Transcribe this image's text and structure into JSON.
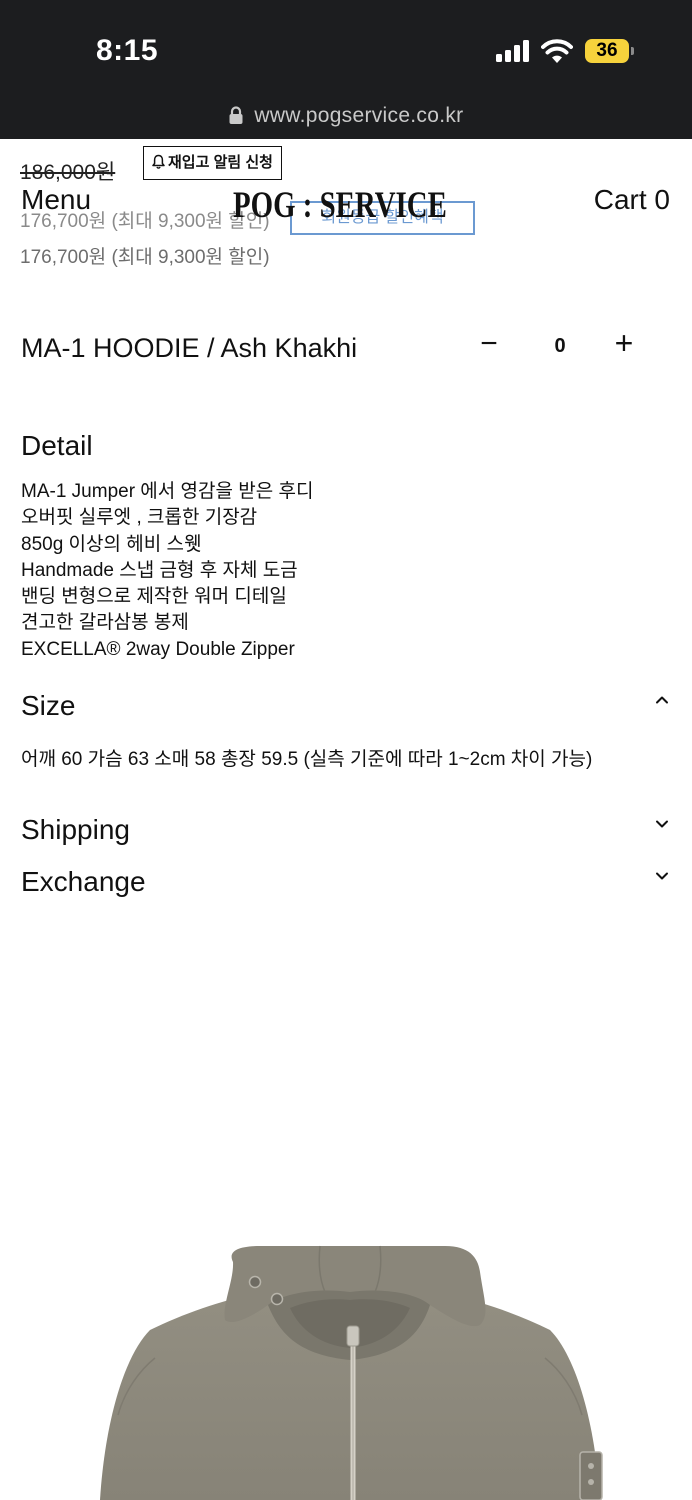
{
  "status_bar": {
    "time": "8:15",
    "battery": "36",
    "url": "www.pogservice.co.kr",
    "icons": [
      "signal-icon",
      "wifi-icon",
      "battery-icon",
      "lock-icon"
    ]
  },
  "header": {
    "menu_label": "Menu",
    "logo_text": "POG : SERVICE",
    "cart_label": "Cart 0"
  },
  "pricing": {
    "original_price": "186,000원",
    "restock_label": "재입고 알림 신청",
    "sale_price_faded": "176,700원 (최대 9,300원 할인)",
    "member_button": "회원등급 할인혜택",
    "sale_price": "176,700원 (최대 9,300원 할인)"
  },
  "product": {
    "name": "MA-1 HOODIE / Ash Khakhi",
    "quantity": "0",
    "minus_label": "−",
    "plus_label": "+"
  },
  "detail": {
    "title": "Detail",
    "lines": [
      "MA-1 Jumper 에서 영감을 받은 후디",
      "오버핏 실루엣 , 크롭한 기장감",
      "850g 이상의 헤비 스웻",
      "Handmade 스냅 금형 후 자체 도금",
      "밴딩 변형으로 제작한 워머 디테일",
      "견고한 갈라삼봉 봉제",
      "EXCELLA® 2way Double Zipper"
    ]
  },
  "size": {
    "title": "Size",
    "text": "어깨 60 가슴 63 소매 58 총장 59.5 (실측 기준에 따라 1~2cm 차이 가능)",
    "expanded": true
  },
  "shipping": {
    "title": "Shipping",
    "expanded": false
  },
  "exchange": {
    "title": "Exchange",
    "expanded": false
  },
  "colors": {
    "status_bg": "#1c1d1f",
    "battery": "#f6d23c",
    "member_blue": "#3a78c2",
    "hoodie": "#8e8a7d"
  }
}
